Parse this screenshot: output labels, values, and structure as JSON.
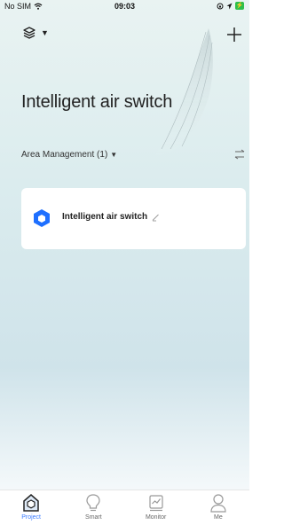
{
  "status_bar": {
    "carrier": "No SIM",
    "time": "09:03",
    "battery_icon": "battery-icon"
  },
  "header": {
    "layers_icon": "layers-icon",
    "add_icon": "plus-icon"
  },
  "project": {
    "title": "Intelligent air switch"
  },
  "area": {
    "label": "Area Management (1)",
    "caret": "▼",
    "sort_icon": "sort-icon"
  },
  "cards": [
    {
      "name": "Intelligent air switch",
      "icon": "cube-icon",
      "edit_icon": "edit-icon"
    }
  ],
  "tabs": [
    {
      "label": "Project",
      "icon": "home-icon",
      "active": true
    },
    {
      "label": "Smart",
      "icon": "bulb-icon",
      "active": false
    },
    {
      "label": "Monitor",
      "icon": "chart-icon",
      "active": false
    },
    {
      "label": "Me",
      "icon": "user-icon",
      "active": false
    }
  ],
  "colors": {
    "accent": "#3b7cff",
    "cube_blue": "#1e6fff"
  }
}
